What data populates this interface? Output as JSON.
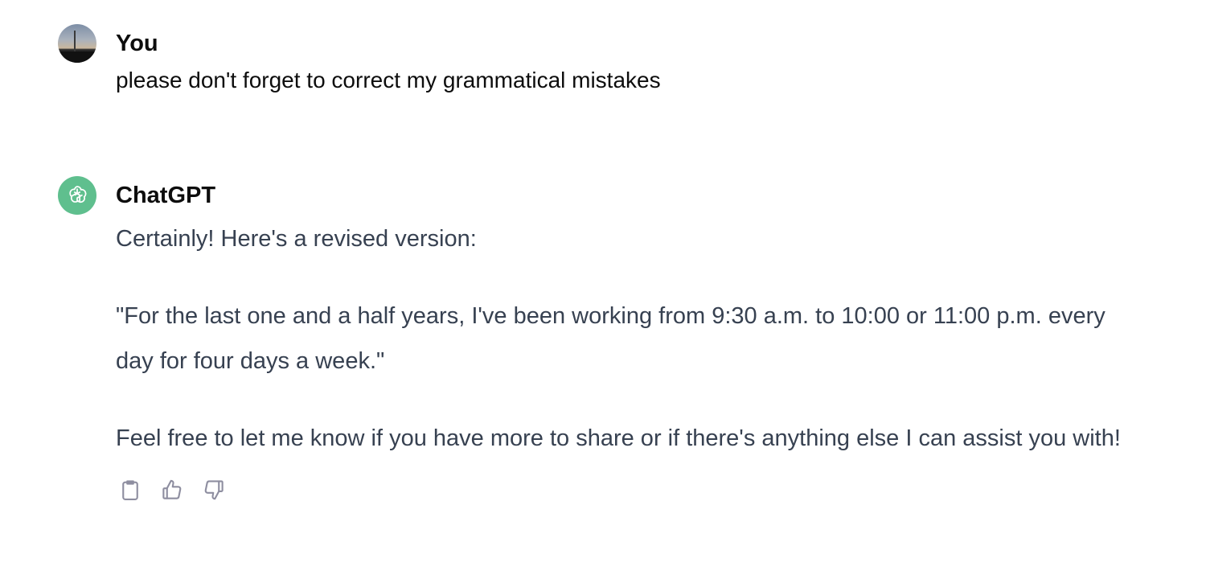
{
  "conversation": {
    "user_message": {
      "author": "You",
      "text": "please don't forget to correct my grammatical mistakes"
    },
    "assistant_message": {
      "author": "ChatGPT",
      "paragraphs": [
        "Certainly! Here's a revised version:",
        "\"For the last one and a half years, I've been working from 9:30 a.m. to 10:00 or 11:00 p.m. every day for four days a week.\"",
        "Feel free to let me know if you have more to share or if there's anything else I can assist you with!"
      ],
      "actions": [
        {
          "name": "copy-button",
          "icon": "clipboard-icon"
        },
        {
          "name": "thumbs-up-button",
          "icon": "thumbs-up-icon"
        },
        {
          "name": "thumbs-down-button",
          "icon": "thumbs-down-icon"
        }
      ]
    }
  },
  "colors": {
    "assistant_avatar": "#5fbf8e",
    "assistant_text": "#374151",
    "user_text": "#0d0d0d",
    "icon_gray": "#8e8ea0"
  }
}
